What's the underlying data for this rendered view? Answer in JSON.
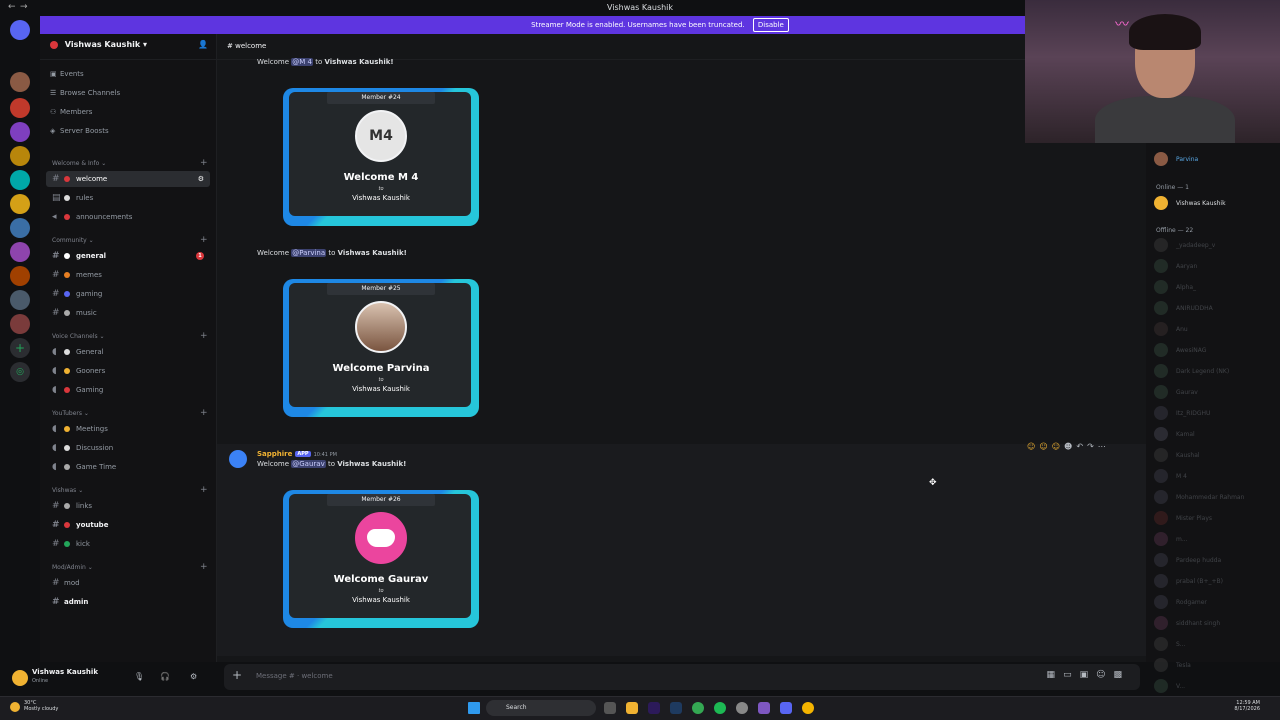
{
  "window": {
    "title": "Vishwas Kaushik"
  },
  "banner": {
    "text": "Streamer Mode is enabled. Usernames have been truncated.",
    "disable": "Disable"
  },
  "server": {
    "name": "Vishwas Kaushik"
  },
  "nav": [
    "Events",
    "Browse Channels",
    "Members",
    "Server Boosts"
  ],
  "categories": {
    "welcome": "Welcome & Info",
    "community": "Community",
    "voice": "Voice Channels",
    "youtubers": "YouTubers",
    "vishwas": "Vishwas",
    "mod": "Mod/Admin"
  },
  "channels": {
    "welcome": "welcome",
    "rules": "rules",
    "announcements": "announcements",
    "general": "general",
    "general_badge": "1",
    "memes": "memes",
    "gaming": "gaming",
    "music": "music",
    "v_general": "General",
    "v_gooners": "Gooners",
    "v_gaming": "Gaming",
    "meetings": "Meetings",
    "discussion": "Discussion",
    "gametime": "Game Time",
    "links": "links",
    "youtube": "youtube",
    "kick": "kick",
    "mod": "mod",
    "admin": "admin"
  },
  "user": {
    "name": "Vishwas Kaushik",
    "status": "Online"
  },
  "chat": {
    "header": "welcome",
    "msg1_pre": "Welcome ",
    "msg1_mention": "@M 4",
    "msg1_post": " to ",
    "msg1_server": "Vishwas Kaushik!",
    "msg2_pre": "Welcome ",
    "msg2_mention": "@Parvina",
    "msg2_post": " to ",
    "msg2_server": "Vishwas Kaushik!",
    "bot_name": "Sapphire",
    "bot_tag": "APP",
    "bot_time": "10:41 PM",
    "msg3_pre": "Welcome ",
    "msg3_mention": "@Gaurav",
    "msg3_post": " to ",
    "msg3_server": "Vishwas Kaushik!",
    "placeholder": "Message #  · welcome"
  },
  "cards": [
    {
      "member": "Member #24",
      "title": "Welcome M 4",
      "to": "to",
      "server": "Vishwas Kaushik"
    },
    {
      "member": "Member #25",
      "title": "Welcome Parvina",
      "to": "to",
      "server": "Vishwas Kaushik"
    },
    {
      "member": "Member #26",
      "title": "Welcome Gaurav",
      "to": "to",
      "server": "Vishwas Kaushik"
    }
  ],
  "members": {
    "top": "Parvina",
    "online_header": "Online — 1",
    "online": [
      "Vishwas Kaushik"
    ],
    "offline_header": "Offline — 22",
    "offline": [
      "_yadadeep_v",
      "Aaryan",
      "Alpha_",
      "ANIRUDDHA",
      "Anu",
      "AwesiNAG",
      "Dark Legend (NK)",
      "Gaurav",
      "Itz_RIDGHU",
      "Kamal",
      "Kaushal",
      "M 4",
      "Mohammedar Rahman",
      "Mister Plays",
      "m...",
      "Pardeep hudda",
      "prabal (B+_+B)",
      "Rodgamer",
      "siddhant singh",
      "S...",
      "Tesla",
      "V..."
    ]
  },
  "taskbar": {
    "temp": "30°C",
    "weather": "Mostly cloudy",
    "search": "Search",
    "time": "12:59 AM",
    "date": "8/17/2026"
  }
}
